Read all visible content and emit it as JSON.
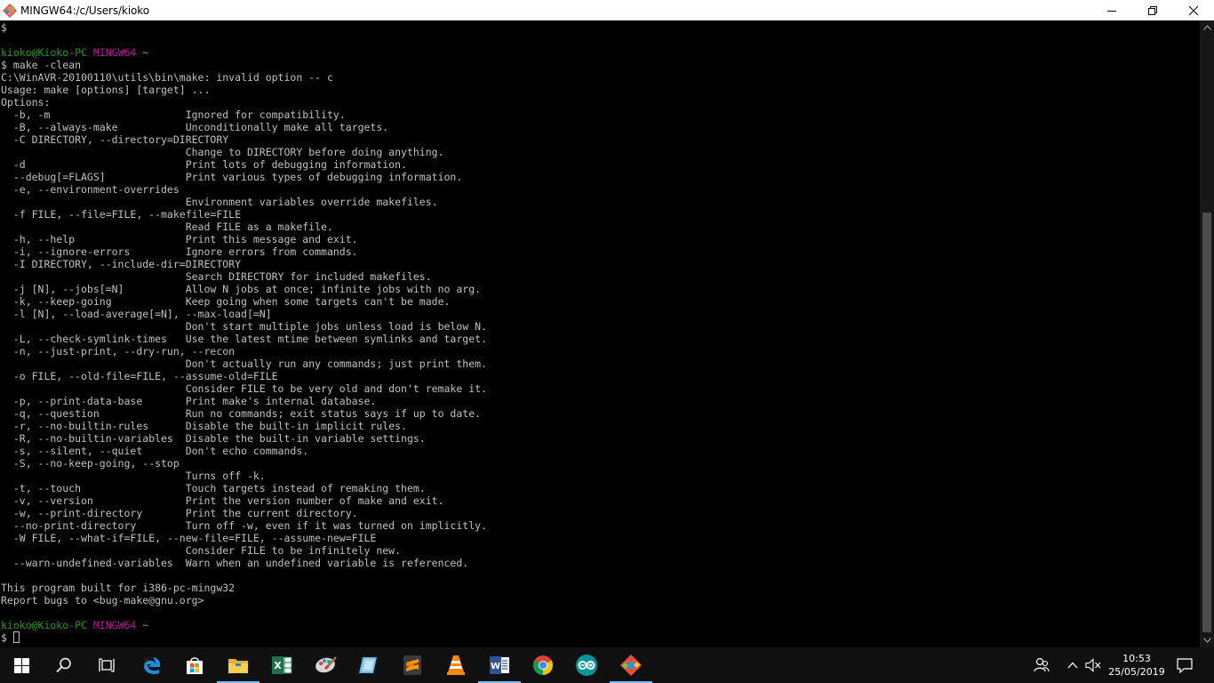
{
  "window": {
    "title": "MINGW64:/c/Users/kioko"
  },
  "terminal": {
    "lines": [
      {
        "type": "text",
        "text": "$"
      },
      {
        "type": "text",
        "text": ""
      },
      {
        "type": "prompt",
        "user": "kioko@Kioko-PC",
        "host": "MINGW64",
        "path": "~"
      },
      {
        "type": "text",
        "text": "$ make -clean"
      },
      {
        "type": "text",
        "text": "C:\\WinAVR-20100110\\utils\\bin\\make: invalid option -- c"
      },
      {
        "type": "text",
        "text": "Usage: make [options] [target] ..."
      },
      {
        "type": "text",
        "text": "Options:"
      },
      {
        "type": "text",
        "text": "  -b, -m                      Ignored for compatibility."
      },
      {
        "type": "text",
        "text": "  -B, --always-make           Unconditionally make all targets."
      },
      {
        "type": "text",
        "text": "  -C DIRECTORY, --directory=DIRECTORY"
      },
      {
        "type": "text",
        "text": "                              Change to DIRECTORY before doing anything."
      },
      {
        "type": "text",
        "text": "  -d                          Print lots of debugging information."
      },
      {
        "type": "text",
        "text": "  --debug[=FLAGS]             Print various types of debugging information."
      },
      {
        "type": "text",
        "text": "  -e, --environment-overrides"
      },
      {
        "type": "text",
        "text": "                              Environment variables override makefiles."
      },
      {
        "type": "text",
        "text": "  -f FILE, --file=FILE, --makefile=FILE"
      },
      {
        "type": "text",
        "text": "                              Read FILE as a makefile."
      },
      {
        "type": "text",
        "text": "  -h, --help                  Print this message and exit."
      },
      {
        "type": "text",
        "text": "  -i, --ignore-errors         Ignore errors from commands."
      },
      {
        "type": "text",
        "text": "  -I DIRECTORY, --include-dir=DIRECTORY"
      },
      {
        "type": "text",
        "text": "                              Search DIRECTORY for included makefiles."
      },
      {
        "type": "text",
        "text": "  -j [N], --jobs[=N]          Allow N jobs at once; infinite jobs with no arg."
      },
      {
        "type": "text",
        "text": "  -k, --keep-going            Keep going when some targets can't be made."
      },
      {
        "type": "text",
        "text": "  -l [N], --load-average[=N], --max-load[=N]"
      },
      {
        "type": "text",
        "text": "                              Don't start multiple jobs unless load is below N."
      },
      {
        "type": "text",
        "text": "  -L, --check-symlink-times   Use the latest mtime between symlinks and target."
      },
      {
        "type": "text",
        "text": "  -n, --just-print, --dry-run, --recon"
      },
      {
        "type": "text",
        "text": "                              Don't actually run any commands; just print them."
      },
      {
        "type": "text",
        "text": "  -o FILE, --old-file=FILE, --assume-old=FILE"
      },
      {
        "type": "text",
        "text": "                              Consider FILE to be very old and don't remake it."
      },
      {
        "type": "text",
        "text": "  -p, --print-data-base       Print make's internal database."
      },
      {
        "type": "text",
        "text": "  -q, --question              Run no commands; exit status says if up to date."
      },
      {
        "type": "text",
        "text": "  -r, --no-builtin-rules      Disable the built-in implicit rules."
      },
      {
        "type": "text",
        "text": "  -R, --no-builtin-variables  Disable the built-in variable settings."
      },
      {
        "type": "text",
        "text": "  -s, --silent, --quiet       Don't echo commands."
      },
      {
        "type": "text",
        "text": "  -S, --no-keep-going, --stop"
      },
      {
        "type": "text",
        "text": "                              Turns off -k."
      },
      {
        "type": "text",
        "text": "  -t, --touch                 Touch targets instead of remaking them."
      },
      {
        "type": "text",
        "text": "  -v, --version               Print the version number of make and exit."
      },
      {
        "type": "text",
        "text": "  -w, --print-directory       Print the current directory."
      },
      {
        "type": "text",
        "text": "  --no-print-directory        Turn off -w, even if it was turned on implicitly."
      },
      {
        "type": "text",
        "text": "  -W FILE, --what-if=FILE, --new-file=FILE, --assume-new=FILE"
      },
      {
        "type": "text",
        "text": "                              Consider FILE to be infinitely new."
      },
      {
        "type": "text",
        "text": "  --warn-undefined-variables  Warn when an undefined variable is referenced."
      },
      {
        "type": "text",
        "text": ""
      },
      {
        "type": "text",
        "text": "This program built for i386-pc-mingw32"
      },
      {
        "type": "text",
        "text": "Report bugs to <bug-make@gnu.org>"
      },
      {
        "type": "text",
        "text": ""
      },
      {
        "type": "prompt",
        "user": "kioko@Kioko-PC",
        "host": "MINGW64",
        "path": "~"
      },
      {
        "type": "input",
        "text": "$ "
      }
    ],
    "colors": {
      "foreground": "#c0c0c0",
      "background": "#000000",
      "user": "#13a10e",
      "host": "#c50f9c",
      "path": "#c19c00"
    }
  },
  "taskbar": {
    "apps": [
      {
        "name": "start-button",
        "icon": "windows-logo-icon",
        "left": 0
      },
      {
        "name": "search-button",
        "icon": "search-icon"
      },
      {
        "name": "task-view-button",
        "icon": "task-view-icon"
      },
      {
        "name": "edge-button",
        "icon": "edge-icon"
      },
      {
        "name": "store-button",
        "icon": "store-icon"
      },
      {
        "name": "file-explorer-button",
        "icon": "folder-icon",
        "running": true
      },
      {
        "name": "excel-button",
        "icon": "excel-icon"
      },
      {
        "name": "paint-button",
        "icon": "paint-icon"
      },
      {
        "name": "notepad-button",
        "icon": "notepad-icon"
      },
      {
        "name": "sublime-button",
        "icon": "sublime-icon"
      },
      {
        "name": "vlc-button",
        "icon": "vlc-icon"
      },
      {
        "name": "word-button",
        "icon": "word-icon",
        "running": true
      },
      {
        "name": "chrome-button",
        "icon": "chrome-icon"
      },
      {
        "name": "arduino-button",
        "icon": "arduino-icon"
      },
      {
        "name": "git-bash-button",
        "icon": "git-icon",
        "running": true
      }
    ],
    "clock": {
      "time": "10:53",
      "date": "25/05/2019"
    },
    "accent": "#76b9ed"
  }
}
